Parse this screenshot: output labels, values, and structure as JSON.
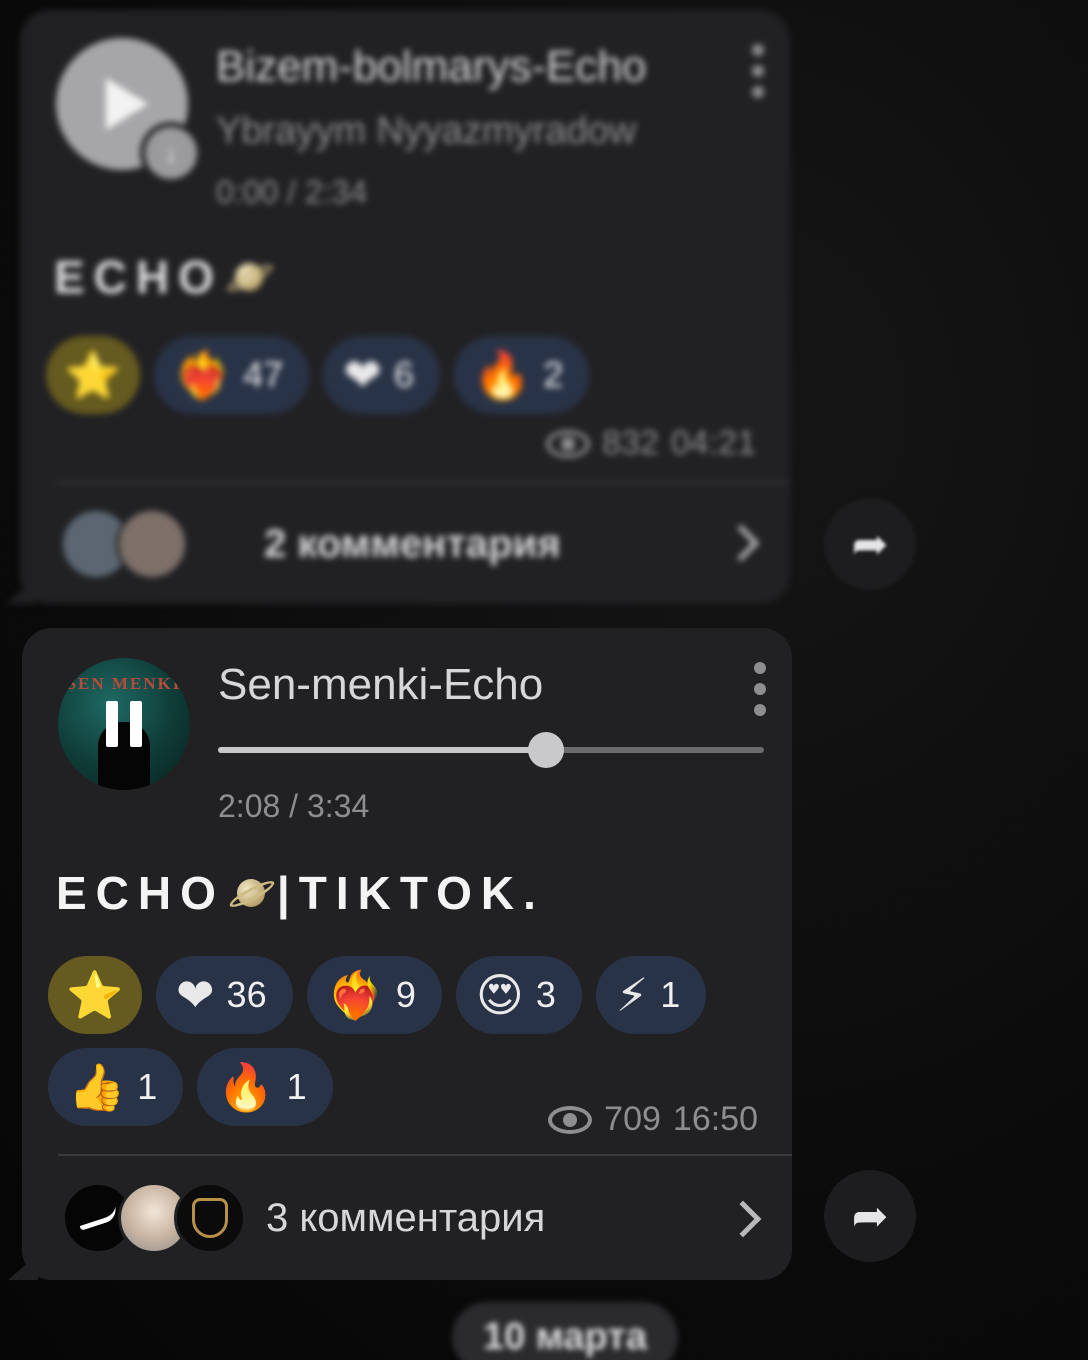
{
  "messages": [
    {
      "track": {
        "title": "Bizem-bolmarys-Echo",
        "artist": "Ybrayym Nyyazmyradow",
        "time": "0:00 / 2:34",
        "state": "paused"
      },
      "caption": {
        "text": "ECHO",
        "suffix": ""
      },
      "reactions": [
        {
          "emoji": "⭐",
          "count": "",
          "type": "star"
        },
        {
          "emoji": "❤‍🔥",
          "count": "47"
        },
        {
          "emoji": "❤",
          "count": "6"
        },
        {
          "emoji": "🔥",
          "count": "2"
        }
      ],
      "views": "832",
      "sent_time": "04:21",
      "comments_label": "2 комментария"
    },
    {
      "track": {
        "title": "Sen-menki-Echo",
        "cover_text": "SEN MENKI",
        "time": "2:08 / 3:34",
        "state": "playing",
        "progress": 0.6
      },
      "caption": {
        "text": "ECHO",
        "suffix": "|TIKTOK."
      },
      "reactions": [
        {
          "emoji": "⭐",
          "count": "",
          "type": "star"
        },
        {
          "emoji": "❤",
          "count": "36"
        },
        {
          "emoji": "❤‍🔥",
          "count": "9"
        },
        {
          "emoji": "😍",
          "count": "3"
        },
        {
          "emoji": "⚡",
          "count": "1"
        },
        {
          "emoji": "👍",
          "count": "1"
        },
        {
          "emoji": "🔥",
          "count": "1"
        }
      ],
      "views": "709",
      "sent_time": "16:50",
      "comments_label": "3 комментария"
    }
  ],
  "date_separator": "10 марта",
  "icons": {
    "share": "share-arrow-icon",
    "views": "eye-icon",
    "more": "more-vertical-icon"
  },
  "colors": {
    "bubble": "#212124",
    "reaction_pill": "#293347",
    "star_pill": "#655a1f"
  }
}
